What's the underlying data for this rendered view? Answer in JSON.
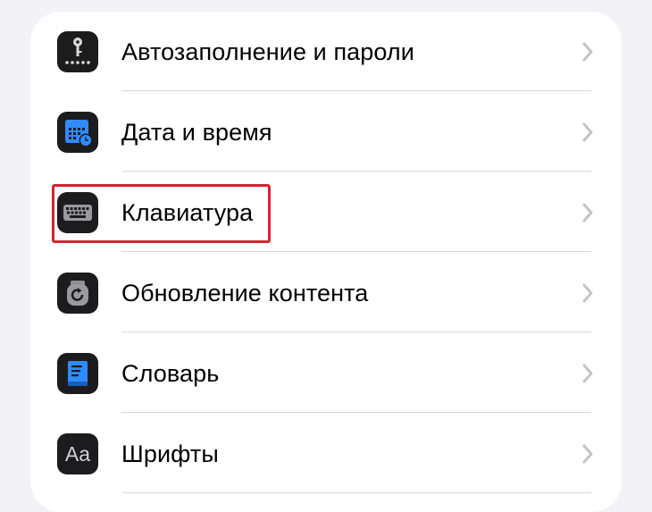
{
  "settings_list": {
    "items": [
      {
        "label": "Автозаполнение и пароли",
        "icon": "key-dots-icon"
      },
      {
        "label": "Дата и время",
        "icon": "calendar-clock-icon"
      },
      {
        "label": "Клавиатура",
        "icon": "keyboard-icon"
      },
      {
        "label": "Обновление контента",
        "icon": "refresh-app-icon"
      },
      {
        "label": "Словарь",
        "icon": "dictionary-book-icon"
      },
      {
        "label": "Шрифты",
        "icon": "fonts-icon",
        "icon_text": "Aa"
      }
    ]
  },
  "highlight": {
    "target": "Клавиатура",
    "color": "#d62330"
  },
  "colors": {
    "background": "#f2f2f7",
    "card": "#ffffff",
    "icon_bg": "#1c1c1e",
    "accent_blue": "#2f8cff",
    "chevron": "#c4c4c7"
  }
}
